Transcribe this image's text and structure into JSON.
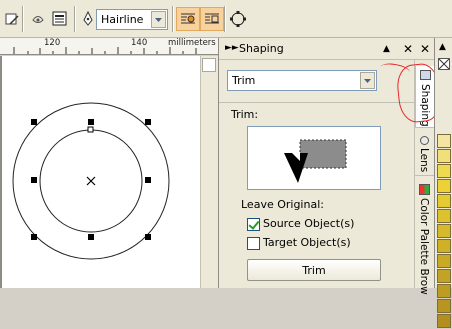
{
  "toolbar": {
    "outline_width": "Hairline",
    "icons": [
      "edit-icon",
      "properties-icon",
      "pen-icon",
      "wrap-text-icon",
      "text-to-path-icon",
      "convert-outline-icon"
    ]
  },
  "ruler": {
    "labels": [
      "120",
      "140"
    ],
    "units": "millimeters"
  },
  "docker": {
    "title": "Shaping",
    "operation": "Trim",
    "section_label": "Trim:",
    "leave_original_label": "Leave Original:",
    "source_object_label": "Source Object(s)",
    "source_object_checked": true,
    "target_object_label": "Target Object(s)",
    "target_object_checked": false,
    "apply_button_label": "Trim"
  },
  "tabs": [
    {
      "label": "Shaping",
      "active": true
    },
    {
      "label": "Lens",
      "active": false
    },
    {
      "label": "Color Palette Brow",
      "active": false
    }
  ],
  "colors": {
    "accent_active": "#f7d29e",
    "annotation": "#e8282b",
    "palette": [
      "#f3e6a2",
      "#f1e07a",
      "#efd94f",
      "#ecd236",
      "#e5cb33",
      "#ddc22f",
      "#d6ba2b",
      "#cfb128",
      "#c9aa26",
      "#c3a324",
      "#bd9c22",
      "#b7951f",
      "#b18e1d"
    ]
  }
}
